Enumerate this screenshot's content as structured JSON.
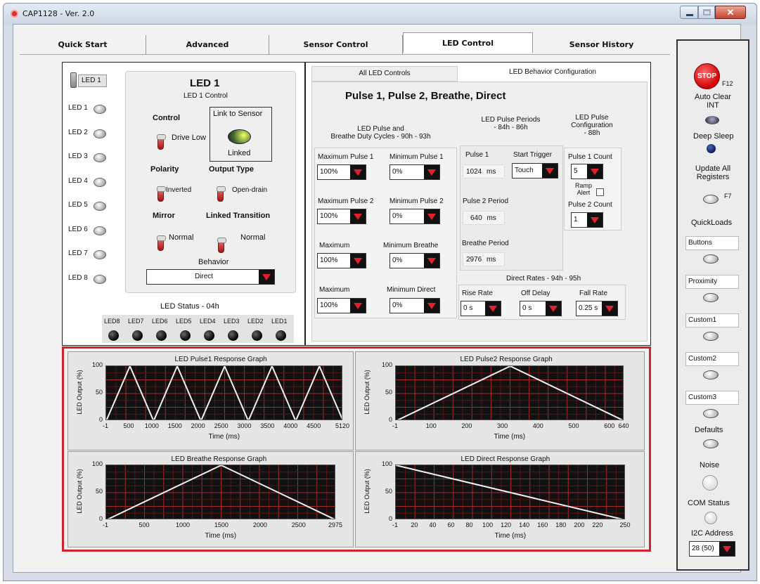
{
  "window": {
    "title": "CAP1128 - Ver. 2.0"
  },
  "tabs": [
    "Quick Start",
    "Advanced",
    "Sensor Control",
    "LED Control",
    "Sensor History"
  ],
  "left_panel": {
    "selector_label": "LED 1",
    "led_list": [
      "LED 1",
      "LED 2",
      "LED 3",
      "LED 4",
      "LED 5",
      "LED 6",
      "LED 7",
      "LED 8"
    ],
    "title": "LED 1",
    "subtitle": "LED 1 Control",
    "control_label": "Control",
    "control_value": "Drive Low",
    "link_label": "Link to Sensor",
    "link_value": "Linked",
    "polarity_label": "Polarity",
    "polarity_value": "Inverted",
    "output_type_label": "Output Type",
    "output_type_value": "Open-drain",
    "mirror_label": "Mirror",
    "mirror_value": "Normal",
    "linked_transition_label": "Linked Transition",
    "linked_transition_value": "Normal",
    "behavior_label": "Behavior",
    "behavior_value": "Direct",
    "status_label": "LED Status - 04h",
    "status_leds": [
      "LED8",
      "LED7",
      "LED6",
      "LED5",
      "LED4",
      "LED3",
      "LED2",
      "LED1"
    ]
  },
  "right_panel": {
    "tab_all": "All LED Controls",
    "tab_behavior": "LED Behavior Configuration",
    "heading": "Pulse 1, Pulse 2, Breathe, Direct",
    "duty_heading": "LED Pulse and\nBreathe Duty Cycles - 90h - 93h",
    "periods_heading": "LED Pulse Periods\n- 84h - 86h",
    "config_heading": "LED Pulse\nConfiguration\n- 88h",
    "max_pulse1_label": "Maximum Pulse 1",
    "max_pulse1": "100%",
    "min_pulse1_label": "Minimum Pulse 1",
    "min_pulse1": "0%",
    "max_pulse2_label": "Maximum Pulse 2",
    "max_pulse2": "100%",
    "min_pulse2_label": "Minimum Pulse 2",
    "min_pulse2": "0%",
    "max_breathe_label": "Maximum",
    "max_breathe": "100%",
    "min_breathe_label": "Minimum Breathe",
    "min_breathe": "0%",
    "max_direct_label": "Maximum",
    "max_direct": "100%",
    "min_direct_label": "Minimum Direct",
    "min_direct": "0%",
    "pulse1_label": "Pulse 1",
    "pulse1_value": "1024",
    "pulse1_unit": "ms",
    "start_trigger_label": "Start Trigger",
    "start_trigger": "Touch",
    "pulse2_period_label": "Pulse 2 Period",
    "pulse2_period": "640",
    "pulse2_unit": "ms",
    "breathe_period_label": "Breathe Period",
    "breathe_period": "2976",
    "breathe_unit": "ms",
    "pulse1_count_label": "Pulse 1 Count",
    "pulse1_count": "5",
    "ramp_alert_label": "Ramp\nAlert",
    "pulse2_count_label": "Pulse 2 Count",
    "pulse2_count": "1",
    "direct_rates_heading": "Direct Rates - 94h - 95h",
    "rise_rate_label": "Rise Rate",
    "rise_rate": "0 s",
    "off_delay_label": "Off Delay",
    "off_delay": "0 s",
    "fall_rate_label": "Fall Rate",
    "fall_rate": "0.25 s"
  },
  "sidebar": {
    "stop_label": "STOP",
    "stop_key": "F12",
    "auto_clear": "Auto Clear\nINT",
    "deep_sleep": "Deep Sleep",
    "update_all": "Update All\nRegisters",
    "update_key": "F7",
    "quickloads": "QuickLoads",
    "presets": [
      "Buttons",
      "Proximity",
      "Custom1",
      "Custom2",
      "Custom3"
    ],
    "defaults": "Defaults",
    "noise": "Noise",
    "com_status": "COM Status",
    "i2c_label": "I2C Address",
    "i2c_value": "28 (50)"
  },
  "graphs": {
    "ylabel": "LED Output (%)",
    "xlabel": "Time (ms)",
    "pulse1": {
      "title": "LED Pulse1 Response Graph",
      "xticks": [
        "-1",
        "500",
        "1000",
        "1500",
        "2000",
        "2500",
        "3000",
        "3500",
        "4000",
        "4500",
        "5120"
      ],
      "yticks": [
        "100",
        "50",
        "0"
      ]
    },
    "pulse2": {
      "title": "LED Pulse2 Response Graph",
      "xticks": [
        "-1",
        "100",
        "200",
        "300",
        "400",
        "500",
        "600",
        "640"
      ],
      "yticks": [
        "100",
        "50",
        "0"
      ]
    },
    "breathe": {
      "title": "LED Breathe Response Graph",
      "xticks": [
        "-1",
        "500",
        "1000",
        "1500",
        "2000",
        "2500",
        "2975"
      ],
      "yticks": [
        "100",
        "50",
        "0"
      ]
    },
    "direct": {
      "title": "LED Direct Response Graph",
      "xticks": [
        "-1",
        "20",
        "40",
        "60",
        "80",
        "100",
        "120",
        "140",
        "160",
        "180",
        "200",
        "220",
        "250"
      ],
      "yticks": [
        "100",
        "50",
        "0"
      ]
    }
  },
  "chart_data": [
    {
      "type": "line",
      "title": "LED Pulse1 Response Graph",
      "xlabel": "Time (ms)",
      "ylabel": "LED Output (%)",
      "xlim": [
        -1,
        5120
      ],
      "ylim": [
        0,
        100
      ],
      "series": [
        {
          "x": [
            -1,
            512,
            1024,
            1536,
            2048,
            2560,
            3072,
            3584,
            4096,
            4608,
            5120
          ],
          "values": [
            0,
            100,
            0,
            100,
            0,
            100,
            0,
            100,
            0,
            100,
            0
          ]
        }
      ]
    },
    {
      "type": "line",
      "title": "LED Pulse2 Response Graph",
      "xlabel": "Time (ms)",
      "ylabel": "LED Output (%)",
      "xlim": [
        -1,
        640
      ],
      "ylim": [
        0,
        100
      ],
      "series": [
        {
          "x": [
            -1,
            320,
            640
          ],
          "values": [
            0,
            100,
            0
          ]
        }
      ]
    },
    {
      "type": "line",
      "title": "LED Breathe Response Graph",
      "xlabel": "Time (ms)",
      "ylabel": "LED Output (%)",
      "xlim": [
        -1,
        2975
      ],
      "ylim": [
        0,
        100
      ],
      "series": [
        {
          "x": [
            -1,
            1488,
            2975
          ],
          "values": [
            0,
            100,
            0
          ]
        }
      ]
    },
    {
      "type": "line",
      "title": "LED Direct Response Graph",
      "xlabel": "Time (ms)",
      "ylabel": "LED Output (%)",
      "xlim": [
        -1,
        250
      ],
      "ylim": [
        0,
        100
      ],
      "series": [
        {
          "x": [
            -1,
            250
          ],
          "values": [
            100,
            0
          ]
        }
      ]
    }
  ]
}
